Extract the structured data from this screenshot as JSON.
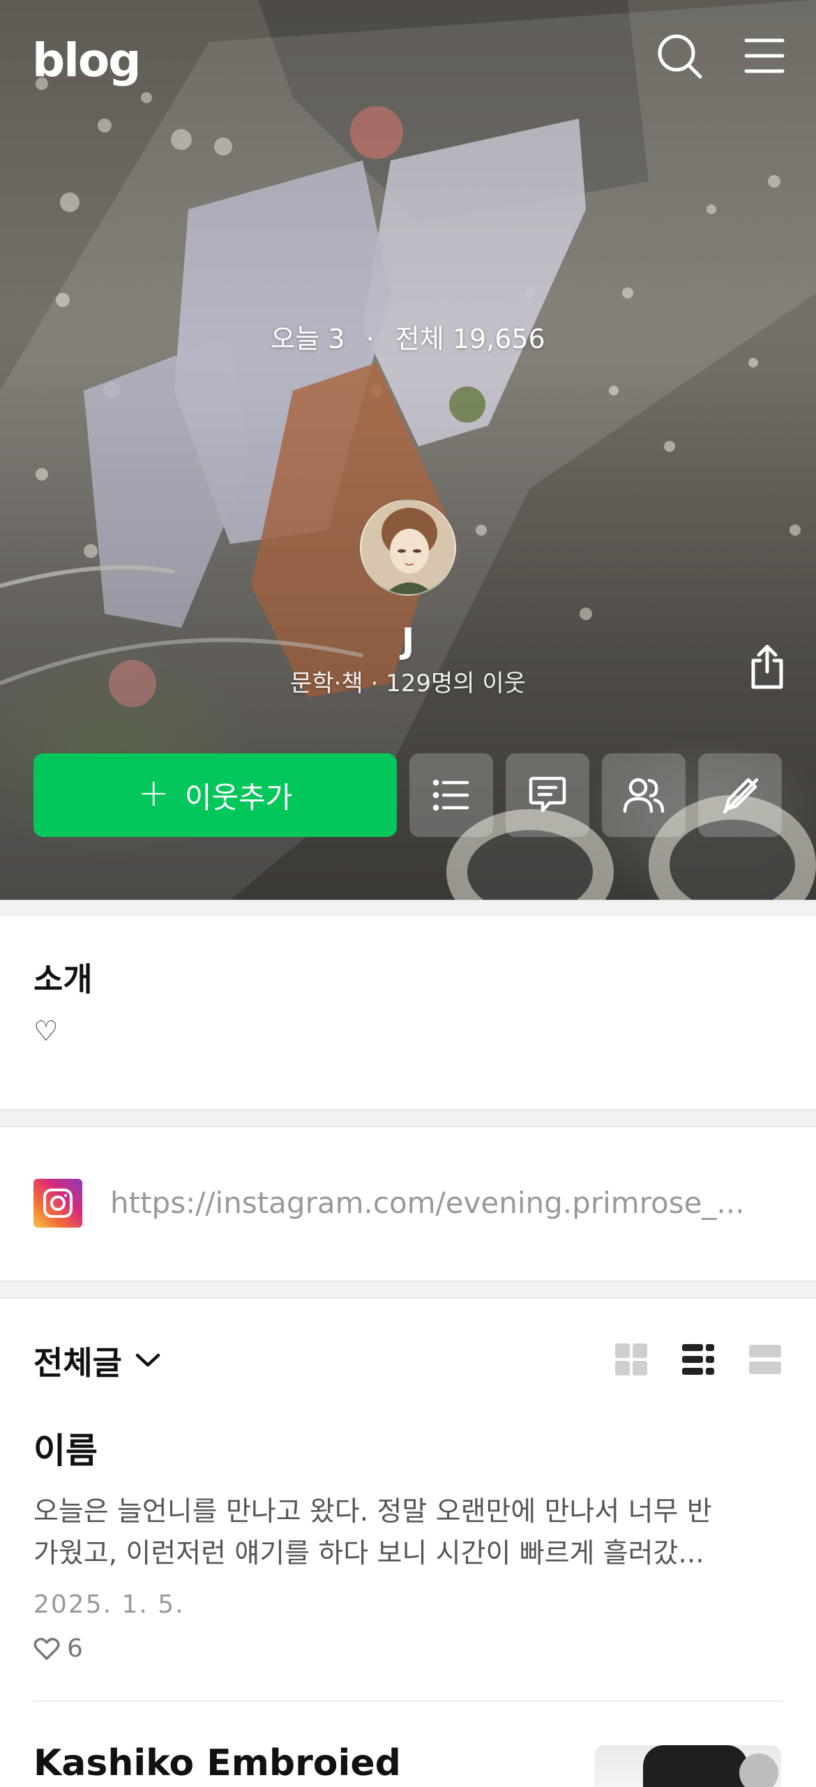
{
  "header": {
    "logo": "blog",
    "search_icon": "search-icon",
    "menu_icon": "menu-icon"
  },
  "profile": {
    "today_label": "오늘",
    "today_count": "3",
    "total_label": "전체",
    "total_count": "19,656",
    "separator": "·",
    "name": "J",
    "meta": "문학·책 · 129명의 이웃",
    "add_neighbor_label": "이웃추가",
    "action_icons": [
      "list-icon",
      "comment-icon",
      "neighbors-icon",
      "edit-disabled-icon",
      "share-icon"
    ]
  },
  "intro": {
    "title": "소개",
    "text": "♡"
  },
  "sns": {
    "icon": "instagram-icon",
    "link": "https://instagram.com/evening.primrose_..."
  },
  "posts": {
    "category_label": "전체글",
    "view_modes": [
      "grid-view-icon",
      "card-list-view-icon",
      "list-view-icon"
    ],
    "items": [
      {
        "title": "이름",
        "excerpt_line1": "오늘은 늘언니를 만나고 왔다. 정말 오랜만에 만나서 너무 반",
        "excerpt_line2": "가웠고, 이런저런 얘기를 하다 보니 시간이 빠르게 흘러갔...",
        "date": "2025. 1. 5.",
        "likes": "6"
      },
      {
        "title": "Kashiko Embroied"
      }
    ]
  },
  "colors": {
    "accent_green": "#03c75a",
    "text_primary": "#111111",
    "text_muted": "#999999"
  }
}
